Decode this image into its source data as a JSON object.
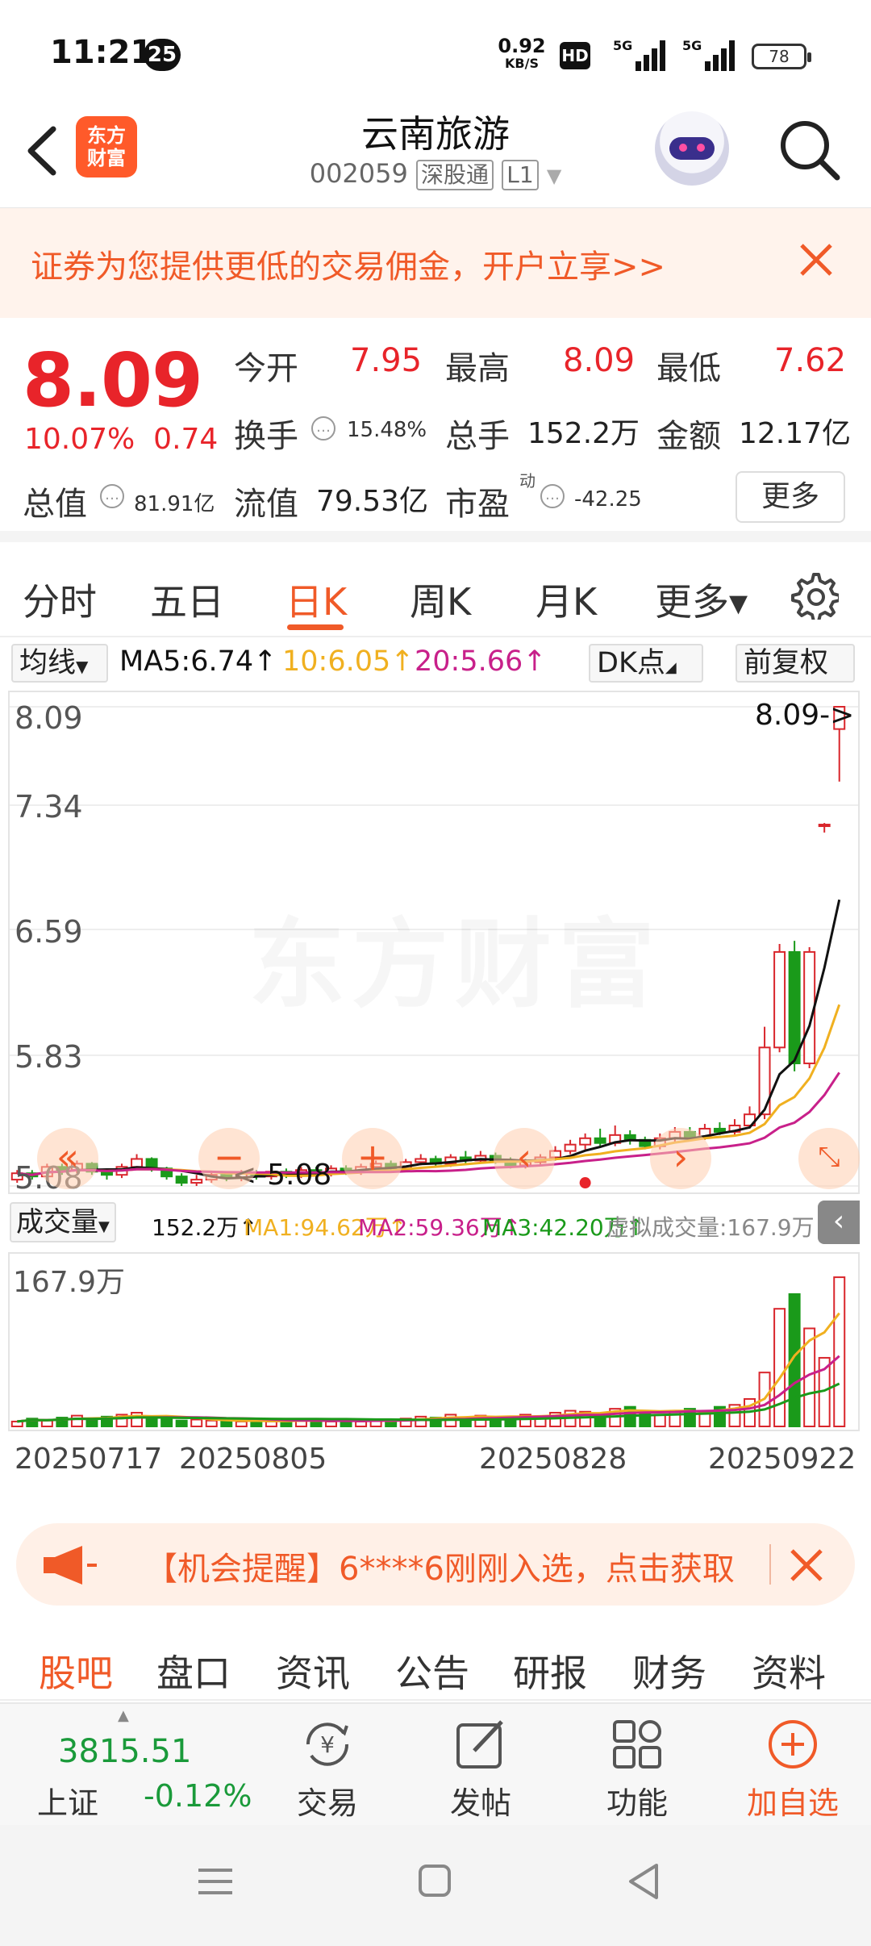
{
  "status_bar": {
    "time": "11:21",
    "notification_count": "25",
    "net_speed": "0.92",
    "net_speed_unit": "KB/S",
    "hd": "HD",
    "signal1": "5G",
    "signal2": "5G",
    "battery": "78"
  },
  "header": {
    "logo_line1": "东方",
    "logo_line2": "财富",
    "stock_name": "云南旅游",
    "stock_code": "002059",
    "tag_connect": "深股通",
    "tag_level": "L1"
  },
  "promo": {
    "text": "证券为您提供更低的交易佣金，开户立享>>"
  },
  "quote": {
    "price": "8.09",
    "change_pct": "10.07%",
    "change_amt": "0.74",
    "open_label": "今开",
    "open": "7.95",
    "high_label": "最高",
    "high": "8.09",
    "low_label": "最低",
    "low": "7.62",
    "turnover_label": "换手",
    "turnover": "15.48%",
    "volume_label": "总手",
    "volume": "152.2万",
    "amount_label": "金额",
    "amount": "12.17亿",
    "mktcap_label": "总值",
    "mktcap": "81.91亿",
    "float_label": "流值",
    "float_cap": "79.53亿",
    "pe_label": "市盈",
    "pe_sup": "动",
    "pe": "-42.25",
    "more_label": "更多"
  },
  "tabs": [
    {
      "label": "分时"
    },
    {
      "label": "五日"
    },
    {
      "label": "日K"
    },
    {
      "label": "周K"
    },
    {
      "label": "月K"
    },
    {
      "label": "更多▾"
    }
  ],
  "ma_line": {
    "selector": "均线",
    "ma5": "MA5:6.74",
    "ma10": "10:6.05",
    "ma20": "20:5.66",
    "dk": "DK点",
    "adjust": "前复权",
    "ma5_color": "#111111",
    "ma10_color": "#f0b020",
    "ma20_color": "#c8208a"
  },
  "chart": {
    "y_ticks": [
      "8.09",
      "7.34",
      "6.59",
      "5.83",
      "5.08"
    ],
    "max_marker": "8.09->",
    "min_marker": "<-5.08",
    "watermark": "东方财富",
    "up_color": "#d9262c",
    "down_color": "#1a9a1a"
  },
  "chart_data": {
    "type": "candlestick",
    "ylim": [
      5.08,
      8.09
    ],
    "x_ticks": [
      "20250717",
      "20250805",
      "20250828",
      "20250922"
    ],
    "candles": [
      [
        5.12,
        5.16,
        5.1,
        5.18
      ],
      [
        5.16,
        5.14,
        5.12,
        5.18
      ],
      [
        5.14,
        5.2,
        5.12,
        5.22
      ],
      [
        5.2,
        5.18,
        5.15,
        5.22
      ],
      [
        5.18,
        5.22,
        5.16,
        5.24
      ],
      [
        5.22,
        5.17,
        5.15,
        5.23
      ],
      [
        5.17,
        5.15,
        5.12,
        5.19
      ],
      [
        5.15,
        5.2,
        5.13,
        5.22
      ],
      [
        5.2,
        5.25,
        5.18,
        5.28
      ],
      [
        5.25,
        5.19,
        5.17,
        5.26
      ],
      [
        5.19,
        5.14,
        5.12,
        5.2
      ],
      [
        5.14,
        5.1,
        5.08,
        5.16
      ],
      [
        5.1,
        5.12,
        5.08,
        5.15
      ],
      [
        5.12,
        5.15,
        5.1,
        5.17
      ],
      [
        5.15,
        5.13,
        5.11,
        5.17
      ],
      [
        5.13,
        5.16,
        5.11,
        5.18
      ],
      [
        5.16,
        5.14,
        5.12,
        5.18
      ],
      [
        5.14,
        5.17,
        5.12,
        5.19
      ],
      [
        5.17,
        5.15,
        5.13,
        5.19
      ],
      [
        5.15,
        5.18,
        5.13,
        5.2
      ],
      [
        5.18,
        5.16,
        5.14,
        5.2
      ],
      [
        5.16,
        5.19,
        5.14,
        5.21
      ],
      [
        5.19,
        5.17,
        5.15,
        5.21
      ],
      [
        5.17,
        5.2,
        5.15,
        5.22
      ],
      [
        5.2,
        5.22,
        5.18,
        5.24
      ],
      [
        5.22,
        5.19,
        5.17,
        5.24
      ],
      [
        5.19,
        5.23,
        5.17,
        5.25
      ],
      [
        5.23,
        5.25,
        5.21,
        5.28
      ],
      [
        5.25,
        5.22,
        5.2,
        5.27
      ],
      [
        5.22,
        5.26,
        5.2,
        5.28
      ],
      [
        5.26,
        5.24,
        5.22,
        5.3
      ],
      [
        5.24,
        5.27,
        5.22,
        5.3
      ],
      [
        5.27,
        5.24,
        5.22,
        5.29
      ],
      [
        5.24,
        5.21,
        5.19,
        5.26
      ],
      [
        5.21,
        5.23,
        5.19,
        5.25
      ],
      [
        5.23,
        5.26,
        5.21,
        5.28
      ],
      [
        5.26,
        5.3,
        5.24,
        5.33
      ],
      [
        5.3,
        5.34,
        5.28,
        5.37
      ],
      [
        5.34,
        5.38,
        5.31,
        5.41
      ],
      [
        5.38,
        5.35,
        5.32,
        5.44
      ],
      [
        5.35,
        5.4,
        5.33,
        5.46
      ],
      [
        5.4,
        5.37,
        5.34,
        5.43
      ],
      [
        5.37,
        5.33,
        5.31,
        5.39
      ],
      [
        5.33,
        5.38,
        5.31,
        5.41
      ],
      [
        5.38,
        5.42,
        5.35,
        5.45
      ],
      [
        5.42,
        5.39,
        5.36,
        5.45
      ],
      [
        5.39,
        5.44,
        5.37,
        5.47
      ],
      [
        5.44,
        5.42,
        5.4,
        5.48
      ],
      [
        5.42,
        5.46,
        5.4,
        5.5
      ],
      [
        5.46,
        5.53,
        5.44,
        5.58
      ],
      [
        5.53,
        5.95,
        5.5,
        6.08
      ],
      [
        5.95,
        6.55,
        5.92,
        6.6
      ],
      [
        6.55,
        5.85,
        5.8,
        6.62
      ],
      [
        5.85,
        6.55,
        5.82,
        6.58
      ],
      [
        7.35,
        7.35,
        7.3,
        7.36
      ],
      [
        7.95,
        8.09,
        7.62,
        8.09
      ]
    ],
    "volume_ylim": [
      0,
      167.9
    ],
    "volume_unit": "万",
    "volumes": [
      5,
      8,
      6,
      9,
      11,
      7,
      10,
      12,
      14,
      9,
      8,
      6,
      7,
      6,
      5,
      5,
      6,
      5,
      6,
      7,
      6,
      5,
      6,
      5,
      7,
      6,
      8,
      10,
      9,
      12,
      8,
      11,
      9,
      10,
      12,
      10,
      14,
      16,
      15,
      13,
      18,
      20,
      14,
      12,
      15,
      18,
      16,
      20,
      22,
      28,
      55,
      120,
      135,
      100,
      70,
      152.2
    ]
  },
  "volume_line": {
    "selector": "成交量",
    "vol": "152.2万",
    "ma1": "MA1:94.62万",
    "ma2": "MA2:59.36万",
    "ma3": "MA3:42.20万",
    "virtual": "虚拟成交量:167.9万",
    "y_tick": "167.9万"
  },
  "alert": {
    "text": "【机会提醒】6****6刚刚入选，点击获取"
  },
  "subtabs": [
    {
      "label": "股吧"
    },
    {
      "label": "盘口"
    },
    {
      "label": "资讯"
    },
    {
      "label": "公告"
    },
    {
      "label": "研报"
    },
    {
      "label": "财务"
    },
    {
      "label": "资料"
    }
  ],
  "bottom_bar": {
    "index_value": "3815.51",
    "index_name": "上证",
    "index_change": "-0.12%",
    "trade": "交易",
    "post": "发帖",
    "func": "功能",
    "add": "加自选"
  }
}
